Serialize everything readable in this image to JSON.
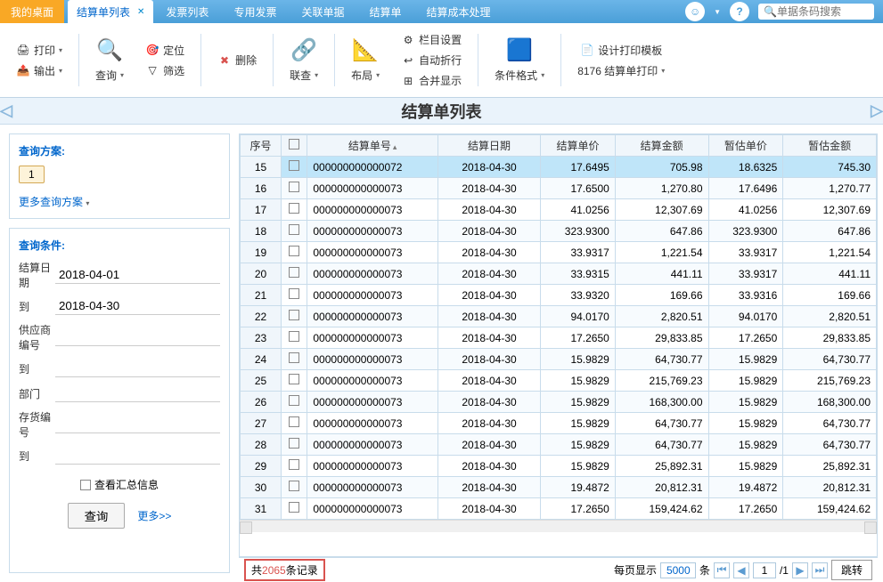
{
  "tabs": {
    "desktop": "我的桌面",
    "active": "结算单列表",
    "others": [
      "发票列表",
      "专用发票",
      "关联单据",
      "结算单",
      "结算成本处理"
    ]
  },
  "search": {
    "placeholder": "单据条码搜索"
  },
  "toolbar": {
    "print": "打印",
    "output": "输出",
    "query": "查询",
    "locate": "定位",
    "filter": "筛选",
    "delete": "删除",
    "lianchaLabel": "联查",
    "layout": "布局",
    "colset": "栏目设置",
    "autowrap": "自动折行",
    "merge": "合并显示",
    "condfmt": "条件格式",
    "designtpl": "设计打印模板",
    "settlePrint": "8176 结算单打印"
  },
  "pageTitle": "结算单列表",
  "sidebar": {
    "schemeTitle": "查询方案:",
    "schemeNum": "1",
    "moreScheme": "更多查询方案",
    "condTitle": "查询条件:",
    "labels": {
      "date": "结算日期",
      "to": "到",
      "supplier": "供应商编号",
      "dept": "部门",
      "stock": "存货编号"
    },
    "values": {
      "dateFrom": "2018-04-01",
      "dateTo": "2018-04-30",
      "supplierFrom": "",
      "supplierTo": "",
      "dept": "",
      "stockFrom": "",
      "stockTo": ""
    },
    "summaryChk": "查看汇总信息",
    "queryBtn": "查询",
    "moreBtn": "更多>>"
  },
  "columns": [
    "序号",
    "",
    "结算单号",
    "结算日期",
    "结算单价",
    "结算金额",
    "暂估单价",
    "暂估金额"
  ],
  "rows": [
    {
      "seq": "15",
      "no": "000000000000072",
      "date": "2018-04-30",
      "p1": "17.6495",
      "a1": "705.98",
      "p2": "18.6325",
      "a2": "745.30",
      "sel": true
    },
    {
      "seq": "16",
      "no": "000000000000073",
      "date": "2018-04-30",
      "p1": "17.6500",
      "a1": "1,270.80",
      "p2": "17.6496",
      "a2": "1,270.77"
    },
    {
      "seq": "17",
      "no": "000000000000073",
      "date": "2018-04-30",
      "p1": "41.0256",
      "a1": "12,307.69",
      "p2": "41.0256",
      "a2": "12,307.69"
    },
    {
      "seq": "18",
      "no": "000000000000073",
      "date": "2018-04-30",
      "p1": "323.9300",
      "a1": "647.86",
      "p2": "323.9300",
      "a2": "647.86"
    },
    {
      "seq": "19",
      "no": "000000000000073",
      "date": "2018-04-30",
      "p1": "33.9317",
      "a1": "1,221.54",
      "p2": "33.9317",
      "a2": "1,221.54"
    },
    {
      "seq": "20",
      "no": "000000000000073",
      "date": "2018-04-30",
      "p1": "33.9315",
      "a1": "441.11",
      "p2": "33.9317",
      "a2": "441.11"
    },
    {
      "seq": "21",
      "no": "000000000000073",
      "date": "2018-04-30",
      "p1": "33.9320",
      "a1": "169.66",
      "p2": "33.9316",
      "a2": "169.66"
    },
    {
      "seq": "22",
      "no": "000000000000073",
      "date": "2018-04-30",
      "p1": "94.0170",
      "a1": "2,820.51",
      "p2": "94.0170",
      "a2": "2,820.51"
    },
    {
      "seq": "23",
      "no": "000000000000073",
      "date": "2018-04-30",
      "p1": "17.2650",
      "a1": "29,833.85",
      "p2": "17.2650",
      "a2": "29,833.85"
    },
    {
      "seq": "24",
      "no": "000000000000073",
      "date": "2018-04-30",
      "p1": "15.9829",
      "a1": "64,730.77",
      "p2": "15.9829",
      "a2": "64,730.77"
    },
    {
      "seq": "25",
      "no": "000000000000073",
      "date": "2018-04-30",
      "p1": "15.9829",
      "a1": "215,769.23",
      "p2": "15.9829",
      "a2": "215,769.23"
    },
    {
      "seq": "26",
      "no": "000000000000073",
      "date": "2018-04-30",
      "p1": "15.9829",
      "a1": "168,300.00",
      "p2": "15.9829",
      "a2": "168,300.00"
    },
    {
      "seq": "27",
      "no": "000000000000073",
      "date": "2018-04-30",
      "p1": "15.9829",
      "a1": "64,730.77",
      "p2": "15.9829",
      "a2": "64,730.77"
    },
    {
      "seq": "28",
      "no": "000000000000073",
      "date": "2018-04-30",
      "p1": "15.9829",
      "a1": "64,730.77",
      "p2": "15.9829",
      "a2": "64,730.77"
    },
    {
      "seq": "29",
      "no": "000000000000073",
      "date": "2018-04-30",
      "p1": "15.9829",
      "a1": "25,892.31",
      "p2": "15.9829",
      "a2": "25,892.31"
    },
    {
      "seq": "30",
      "no": "000000000000073",
      "date": "2018-04-30",
      "p1": "19.4872",
      "a1": "20,812.31",
      "p2": "19.4872",
      "a2": "20,812.31"
    },
    {
      "seq": "31",
      "no": "000000000000073",
      "date": "2018-04-30",
      "p1": "17.2650",
      "a1": "159,424.62",
      "p2": "17.2650",
      "a2": "159,424.62"
    }
  ],
  "footer": {
    "totalPrefix": "共",
    "totalNum": "2065",
    "totalSuffix": "条记录",
    "perPage": "每页显示",
    "perPageVal": "5000",
    "perPageUnit": "条",
    "pageVal": "1",
    "pageTotal": "/1",
    "jump": "跳转"
  }
}
